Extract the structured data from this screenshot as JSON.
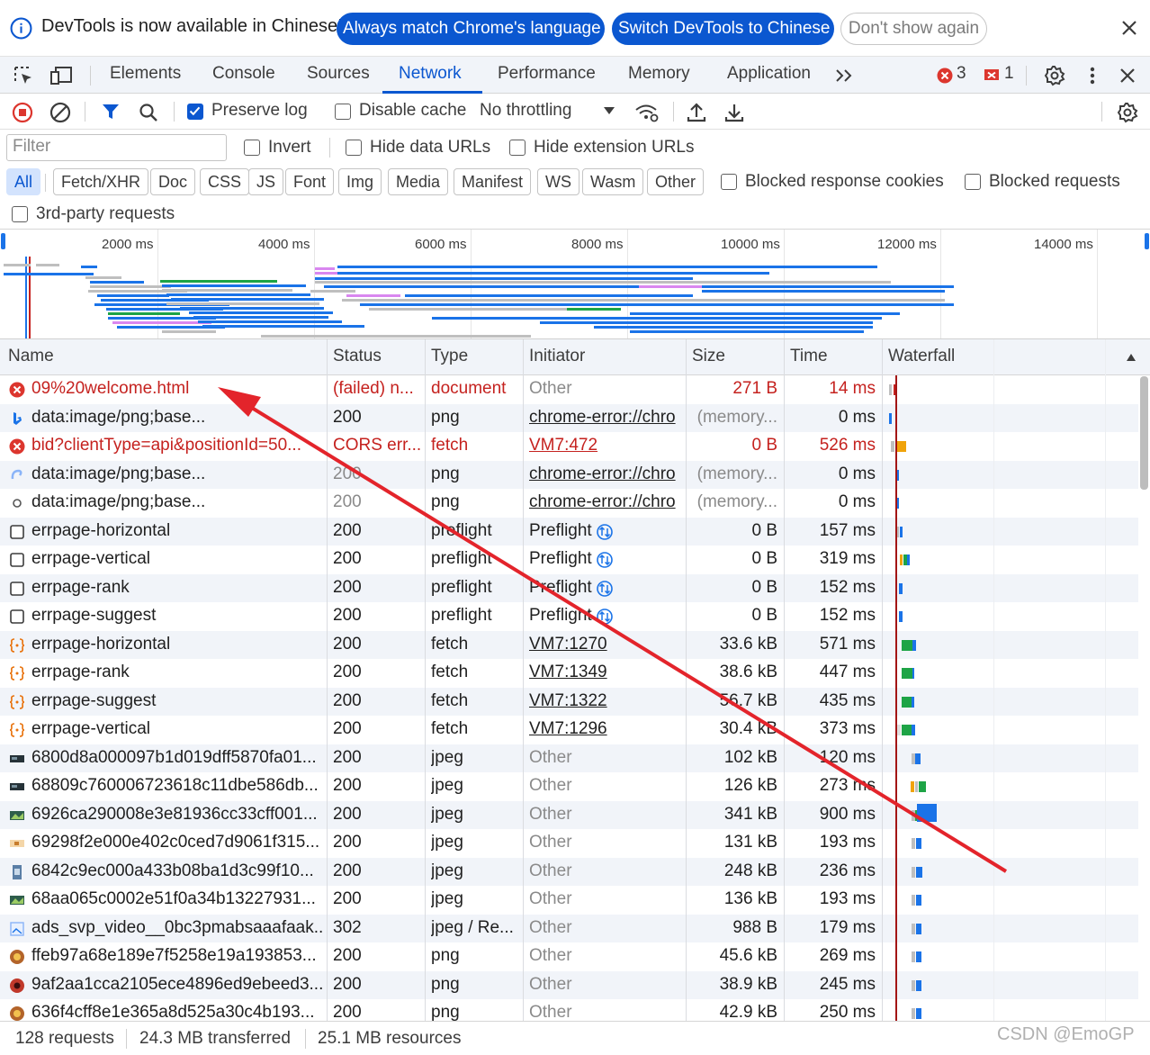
{
  "banner": {
    "message": "DevTools is now available in Chinese!",
    "btn_match": "Always match Chrome's language",
    "btn_switch": "Switch DevTools to Chinese",
    "btn_dismiss": "Don't show again"
  },
  "tabs": {
    "elements": "Elements",
    "console": "Console",
    "sources": "Sources",
    "network": "Network",
    "performance": "Performance",
    "memory": "Memory",
    "application": "Application",
    "more": ">>",
    "error_count": "3",
    "warning_count": "1"
  },
  "toolbar": {
    "preserve_log": "Preserve log",
    "disable_cache": "Disable cache",
    "throttling": "No throttling"
  },
  "filter": {
    "placeholder": "Filter",
    "invert": "Invert",
    "hide_data_urls": "Hide data URLs",
    "hide_extension_urls": "Hide extension URLs",
    "chips": [
      "All",
      "Fetch/XHR",
      "Doc",
      "CSS",
      "JS",
      "Font",
      "Img",
      "Media",
      "Manifest",
      "WS",
      "Wasm",
      "Other"
    ],
    "blocked_cookies": "Blocked response cookies",
    "blocked_requests": "Blocked requests",
    "third_party": "3rd-party requests"
  },
  "overview": {
    "ticks": [
      "2000 ms",
      "4000 ms",
      "6000 ms",
      "8000 ms",
      "10000 ms",
      "12000 ms",
      "14000 ms"
    ]
  },
  "table": {
    "headers": {
      "name": "Name",
      "status": "Status",
      "type": "Type",
      "initiator": "Initiator",
      "size": "Size",
      "time": "Time",
      "waterfall": "Waterfall"
    },
    "rows": [
      {
        "name": "09%20welcome.html",
        "status": "(failed) n...",
        "type": "document",
        "initiator": "Other",
        "size": "271 B",
        "time": "14 ms"
      },
      {
        "name": "data:image/png;base...",
        "status": "200",
        "type": "png",
        "initiator": "chrome-error://chro",
        "size": "(memory...",
        "time": "0 ms"
      },
      {
        "name": "bid?clientType=api&positionId=50...",
        "status": "CORS err...",
        "type": "fetch",
        "initiator": "VM7:472",
        "size": "0 B",
        "time": "526 ms"
      },
      {
        "name": "data:image/png;base...",
        "status": "200",
        "type": "png",
        "initiator": "chrome-error://chro",
        "size": "(memory...",
        "time": "0 ms"
      },
      {
        "name": "data:image/png;base...",
        "status": "200",
        "type": "png",
        "initiator": "chrome-error://chro",
        "size": "(memory...",
        "time": "0 ms"
      },
      {
        "name": "errpage-horizontal",
        "status": "200",
        "type": "preflight",
        "initiator": "Preflight",
        "size": "0 B",
        "time": "157 ms"
      },
      {
        "name": "errpage-vertical",
        "status": "200",
        "type": "preflight",
        "initiator": "Preflight",
        "size": "0 B",
        "time": "319 ms"
      },
      {
        "name": "errpage-rank",
        "status": "200",
        "type": "preflight",
        "initiator": "Preflight",
        "size": "0 B",
        "time": "152 ms"
      },
      {
        "name": "errpage-suggest",
        "status": "200",
        "type": "preflight",
        "initiator": "Preflight",
        "size": "0 B",
        "time": "152 ms"
      },
      {
        "name": "errpage-horizontal",
        "status": "200",
        "type": "fetch",
        "initiator": "VM7:1270",
        "size": "33.6 kB",
        "time": "571 ms"
      },
      {
        "name": "errpage-rank",
        "status": "200",
        "type": "fetch",
        "initiator": "VM7:1349",
        "size": "38.6 kB",
        "time": "447 ms"
      },
      {
        "name": "errpage-suggest",
        "status": "200",
        "type": "fetch",
        "initiator": "VM7:1322",
        "size": "56.7 kB",
        "time": "435 ms"
      },
      {
        "name": "errpage-vertical",
        "status": "200",
        "type": "fetch",
        "initiator": "VM7:1296",
        "size": "30.4 kB",
        "time": "373 ms"
      },
      {
        "name": "6800d8a000097b1d019dff5870fa01...",
        "status": "200",
        "type": "jpeg",
        "initiator": "Other",
        "size": "102 kB",
        "time": "120 ms"
      },
      {
        "name": "68809c760006723618c11dbe586db...",
        "status": "200",
        "type": "jpeg",
        "initiator": "Other",
        "size": "126 kB",
        "time": "273 ms"
      },
      {
        "name": "6926ca290008e3e81936cc33cff001...",
        "status": "200",
        "type": "jpeg",
        "initiator": "Other",
        "size": "341 kB",
        "time": "900 ms"
      },
      {
        "name": "69298f2e000e402c0ced7d9061f315...",
        "status": "200",
        "type": "jpeg",
        "initiator": "Other",
        "size": "131 kB",
        "time": "193 ms"
      },
      {
        "name": "6842c9ec000a433b08ba1d3c99f10...",
        "status": "200",
        "type": "jpeg",
        "initiator": "Other",
        "size": "248 kB",
        "time": "236 ms"
      },
      {
        "name": "68aa065c0002e51f0a34b13227931...",
        "status": "200",
        "type": "jpeg",
        "initiator": "Other",
        "size": "136 kB",
        "time": "193 ms"
      },
      {
        "name": "ads_svp_video__0bc3pmabsaaafaak...",
        "status": "302",
        "type": "jpeg / Re...",
        "initiator": "Other",
        "size": "988 B",
        "time": "179 ms"
      },
      {
        "name": "ffeb97a68e189e7f5258e19a193853...",
        "status": "200",
        "type": "png",
        "initiator": "Other",
        "size": "45.6 kB",
        "time": "269 ms"
      },
      {
        "name": "9af2aa1cca2105ece4896ed9ebeed3...",
        "status": "200",
        "type": "png",
        "initiator": "Other",
        "size": "38.9 kB",
        "time": "245 ms"
      },
      {
        "name": "636f4cff8e1e365a8d525a30c4b193...",
        "status": "200",
        "type": "png",
        "initiator": "Other",
        "size": "42.9 kB",
        "time": "250 ms"
      }
    ]
  },
  "statusbar": {
    "requests": "128 requests",
    "transferred": "24.3 MB transferred",
    "resources": "25.1 MB resources"
  },
  "watermark": "CSDN @EmoGP",
  "colors": {
    "accent": "#0b57d0",
    "error": "#c5221f",
    "waterfall_green": "#1ea446",
    "waterfall_blue": "#1a73e8",
    "waterfall_orange": "#f0a30a",
    "annotation_arrow": "#e3242b"
  }
}
